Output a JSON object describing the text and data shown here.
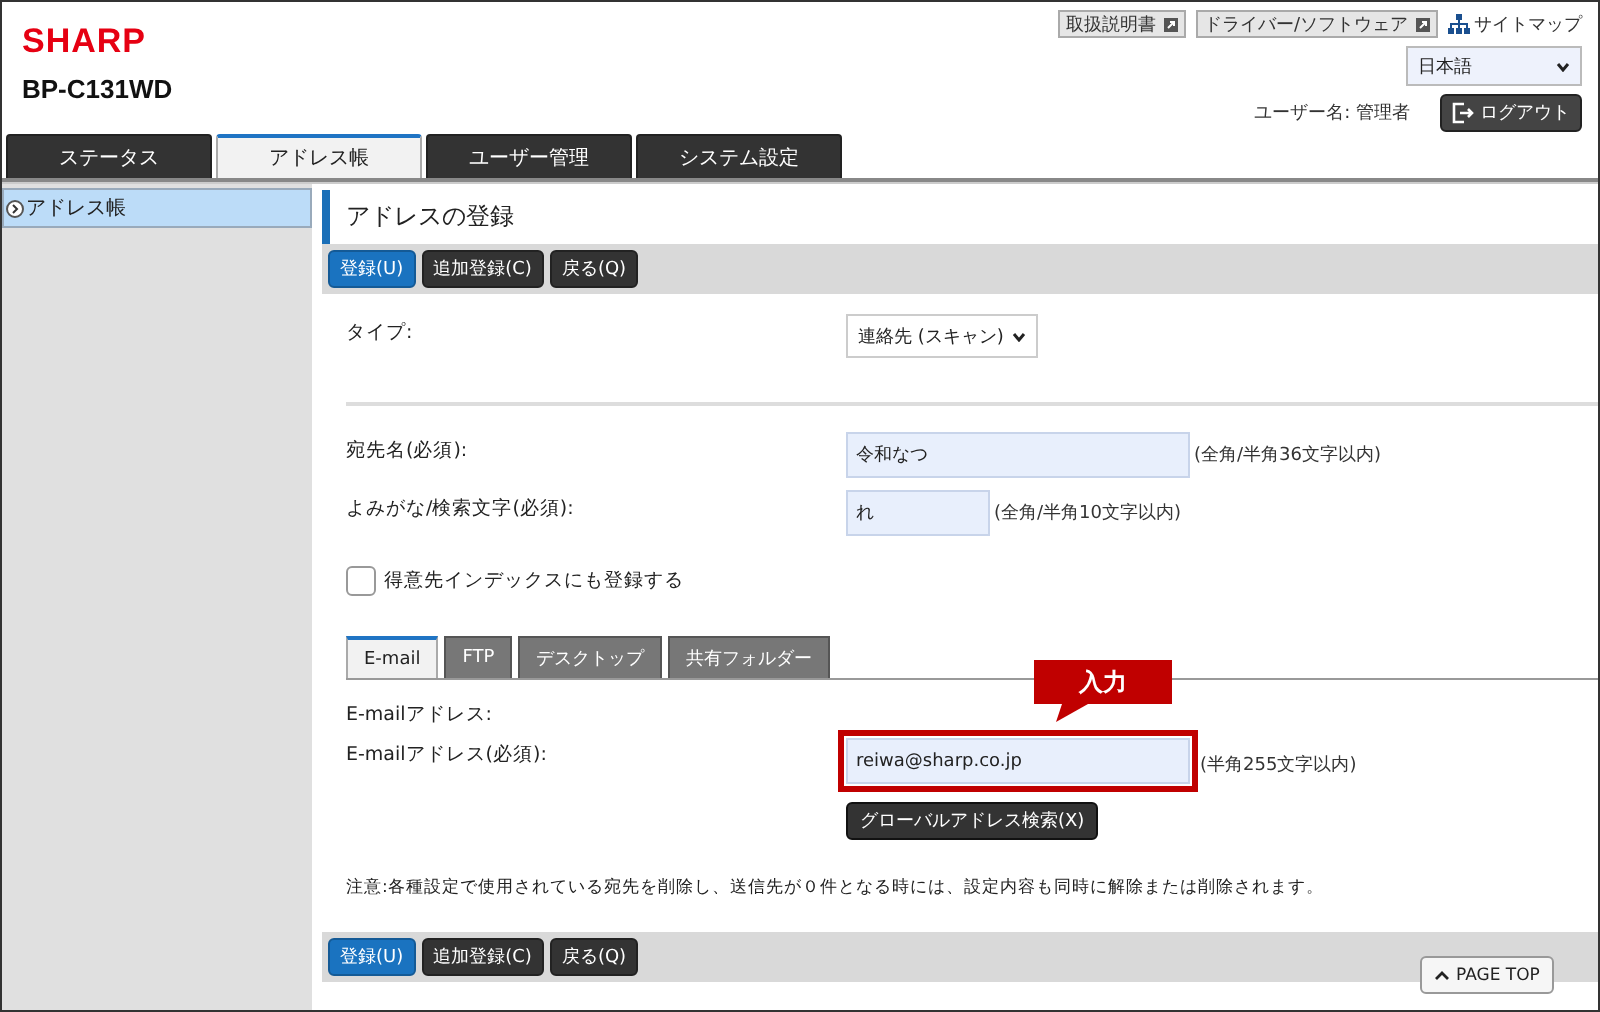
{
  "header": {
    "logo": "SHARP",
    "model": "BP-C131WD",
    "links": [
      {
        "label": "取扱説明書"
      },
      {
        "label": "ドライバー/ソフトウェア"
      }
    ],
    "sitemap": "サイトマップ",
    "language": {
      "value": "日本語"
    },
    "user_label": "ユーザー名: 管理者",
    "logout": "ログアウト"
  },
  "tabs": [
    {
      "label": "ステータス",
      "selected": false
    },
    {
      "label": "アドレス帳",
      "selected": true
    },
    {
      "label": "ユーザー管理",
      "selected": false
    },
    {
      "label": "システム設定",
      "selected": false
    }
  ],
  "sidebar": {
    "items": [
      {
        "label": "アドレス帳",
        "selected": true
      }
    ]
  },
  "page_title": "アドレスの登録",
  "toolbar": {
    "buttons": [
      {
        "label": "登録(U)",
        "kind": "primary"
      },
      {
        "label": "追加登録(C)",
        "kind": "secondary"
      },
      {
        "label": "戻る(Q)",
        "kind": "secondary"
      }
    ]
  },
  "form": {
    "type": {
      "label": "タイプ:",
      "value": "連絡先 (スキャン)"
    },
    "fields": [
      {
        "label": "宛先名(必須):",
        "value": "令和なつ",
        "hint": "(全角/半角36文字以内)"
      },
      {
        "label": "よみがな/検索文字(必須):",
        "value": "れ",
        "hint": "(全角/半角10文字以内)"
      }
    ],
    "index_checkbox": {
      "label": "得意先インデックスにも登録する",
      "checked": false
    }
  },
  "sub_tabs": [
    {
      "label": "E-mail",
      "selected": true
    },
    {
      "label": "FTP",
      "selected": false
    },
    {
      "label": "デスクトップ",
      "selected": false
    },
    {
      "label": "共有フォルダー",
      "selected": false
    }
  ],
  "email": {
    "section_label": "E-mailアドレス:",
    "label": "E-mailアドレス(必須):",
    "value": "reiwa@sharp.co.jp",
    "hint": "(半角255文字以内)",
    "search_button": "グローバルアドレス検索(X)"
  },
  "callout": "入力",
  "note": "注意:各種設定で使用されている宛先を削除し、送信先が０件となる時には、設定内容も同時に解除または削除されます。",
  "bottom_toolbar": {
    "buttons": [
      {
        "label": "登録(U)",
        "kind": "primary"
      },
      {
        "label": "追加登録(C)",
        "kind": "secondary"
      },
      {
        "label": "戻る(Q)",
        "kind": "secondary"
      }
    ]
  },
  "page_top": "PAGE TOP"
}
